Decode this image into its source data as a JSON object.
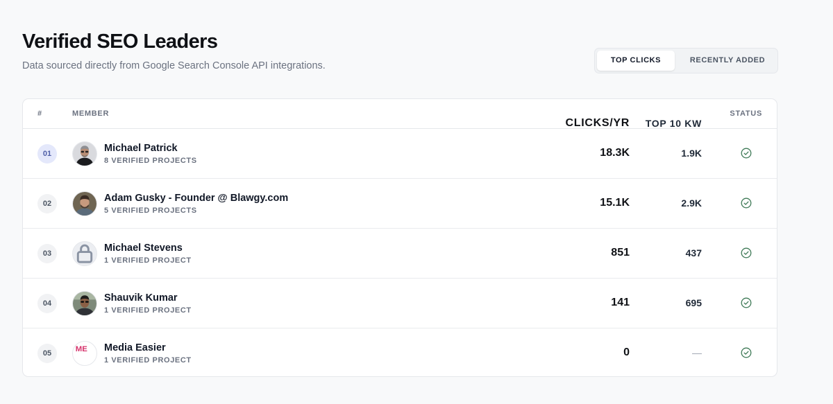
{
  "header": {
    "title": "Verified SEO Leaders",
    "subtitle": "Data sourced directly from Google Search Console API integrations."
  },
  "toggle": {
    "active_label": "TOP CLICKS",
    "inactive_label": "RECENTLY ADDED"
  },
  "table": {
    "columns": {
      "rank": "#",
      "member": "MEMBER",
      "clicks": "CLICKS/YR",
      "kw": "TOP 10 KW",
      "status": "STATUS"
    },
    "rows": [
      {
        "rank": "01",
        "name": "Michael Patrick",
        "projects": "8 VERIFIED PROJECTS",
        "clicks": "18.3K",
        "kw": "1.9K",
        "status": "check-circle-icon",
        "avatar": "photo"
      },
      {
        "rank": "02",
        "name": "Adam Gusky - Founder @ Blawgy.com",
        "projects": "5 VERIFIED PROJECTS",
        "clicks": "15.1K",
        "kw": "2.9K",
        "status": "check-circle-icon",
        "avatar": "photo"
      },
      {
        "rank": "03",
        "name": "Michael Stevens",
        "projects": "1 VERIFIED PROJECT",
        "clicks": "851",
        "kw": "437",
        "status": "check-circle-icon",
        "avatar": "lock-icon"
      },
      {
        "rank": "04",
        "name": "Shauvik Kumar",
        "projects": "1 VERIFIED PROJECT",
        "clicks": "141",
        "kw": "695",
        "status": "check-circle-icon",
        "avatar": "photo"
      },
      {
        "rank": "05",
        "name": "Media Easier",
        "projects": "1 VERIFIED PROJECT",
        "clicks": "0",
        "kw": "—",
        "status": "check-circle-icon",
        "avatar": "logo",
        "logo_text": "ME"
      }
    ]
  },
  "colors": {
    "accent_rank_bg": "#e4e8fb",
    "status_green": "#3f7a57",
    "logo_pink": "#d6336c"
  }
}
